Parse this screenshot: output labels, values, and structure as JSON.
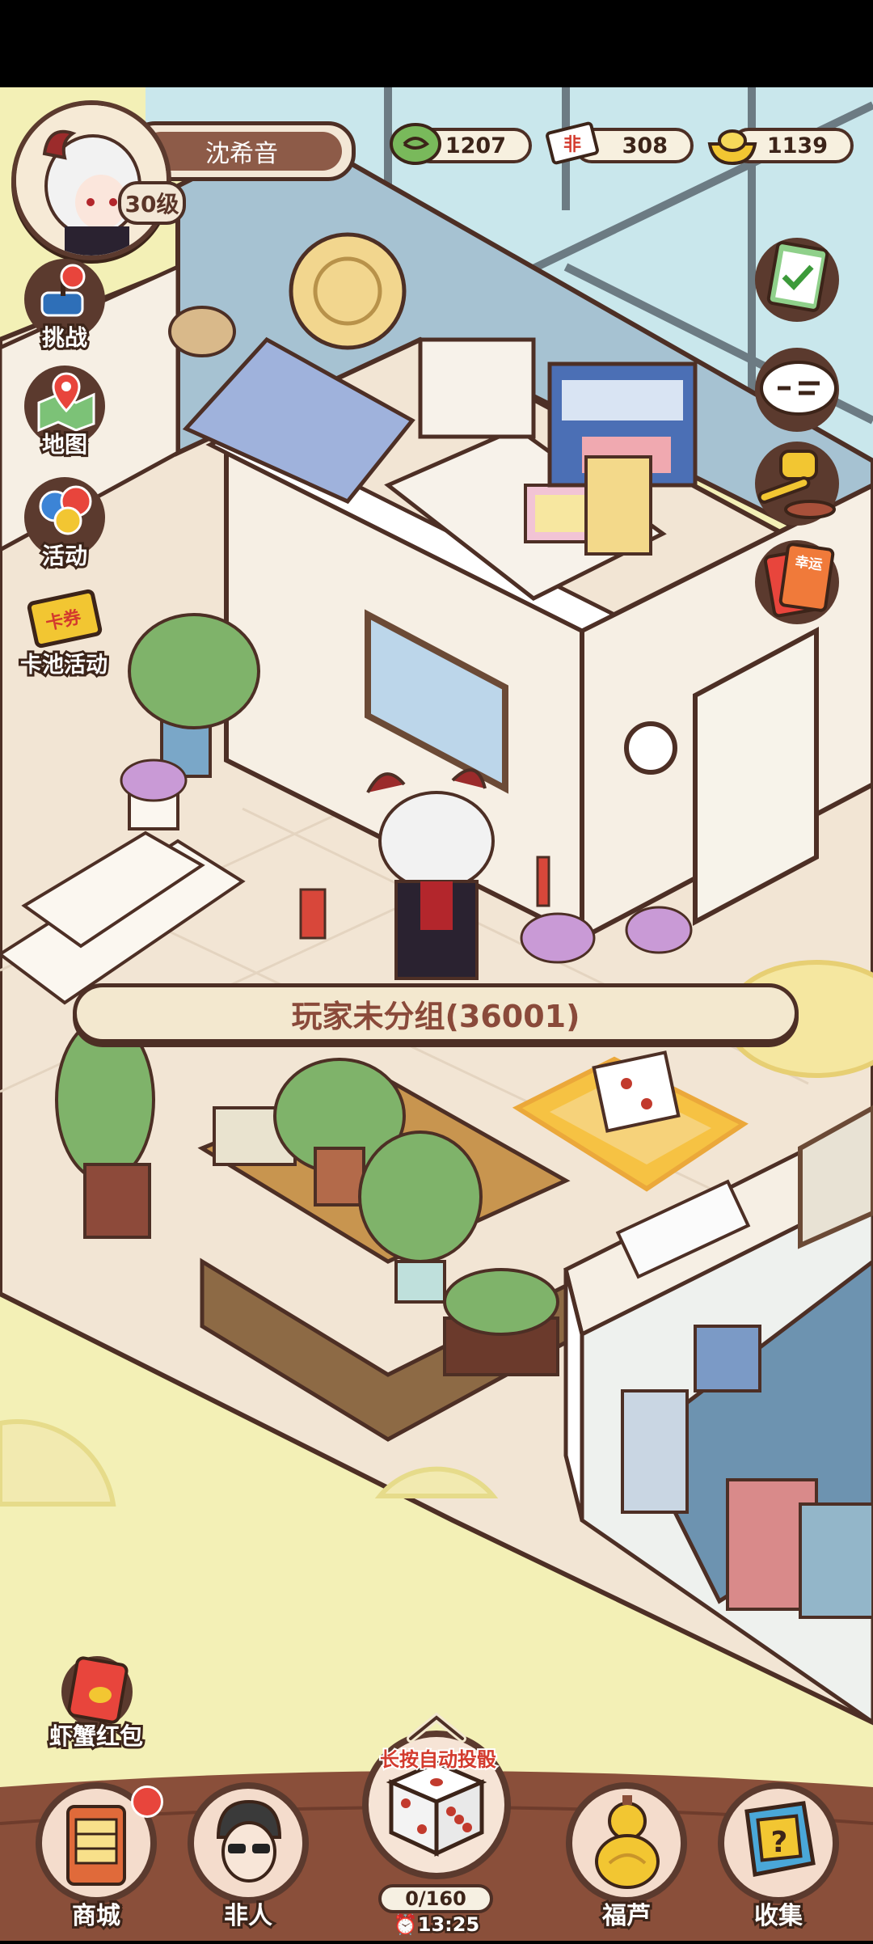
{
  "player": {
    "name": "沈希音",
    "level": "30级"
  },
  "currencies": [
    {
      "icon": "leaf-currency-icon",
      "value": "1207"
    },
    {
      "icon": "ticket-icon",
      "value": "308"
    },
    {
      "icon": "gold-ingot-icon",
      "value": "1139"
    }
  ],
  "ticket_char": "非",
  "left_menu": [
    {
      "label": "挑战",
      "icon": "joystick-icon"
    },
    {
      "label": "地图",
      "icon": "map-pin-icon"
    },
    {
      "label": "活动",
      "icon": "balloons-icon"
    },
    {
      "label": "卡池活动",
      "icon": "card-ticket-icon",
      "badge": "卡券"
    }
  ],
  "right_menu": [
    {
      "icon": "task-clipboard-icon"
    },
    {
      "icon": "chat-bubble-icon"
    },
    {
      "icon": "auction-hammer-icon"
    },
    {
      "icon": "lucky-card-icon",
      "badge": "幸运"
    }
  ],
  "group_banner": "玩家未分组(36001)",
  "red_packet": {
    "label": "虾蟹红包"
  },
  "bottom_nav": [
    {
      "label": "商城",
      "icon": "shop-icon"
    },
    {
      "label": "非人",
      "icon": "character-icon"
    },
    {
      "label": "福芦",
      "icon": "gourd-icon"
    },
    {
      "label": "收集",
      "icon": "mystery-box-icon"
    }
  ],
  "dice": {
    "auto_text": "长按自动投骰",
    "progress": "0/160",
    "timer": "⏰13:25"
  },
  "colors": {
    "outline": "#4d2f25",
    "floor": "#f2e7d6",
    "grass": "#f3f0b4",
    "wall_blue": "#a9c4d4",
    "notify": "#e8453c"
  }
}
